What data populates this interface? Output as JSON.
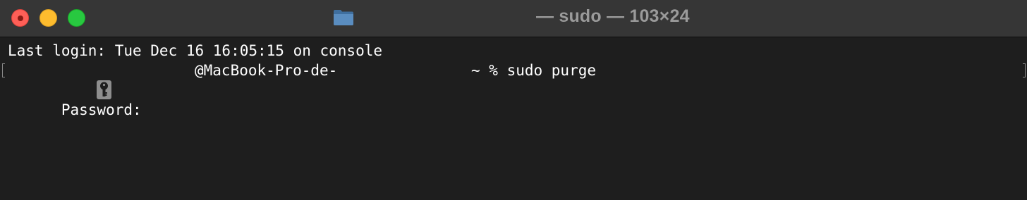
{
  "window": {
    "title": "— sudo — 103×24",
    "folder_icon": "folder-icon",
    "controls": [
      "close-button",
      "minimize-button",
      "zoom-button"
    ]
  },
  "terminal": {
    "line1": "Last login: Tue Dec 16 16:05:15 on console",
    "prompt_host": "@MacBook-Pro-de-",
    "prompt_cmd": "~ % sudo purge",
    "password_label": "Password:",
    "cursor_icon": "key-icon"
  },
  "colors": {
    "background": "#1e1e1e",
    "titlebar": "#363636",
    "text": "#ffffff",
    "close": "#ff5f57",
    "minimize": "#febc2e",
    "zoom": "#28c840"
  }
}
